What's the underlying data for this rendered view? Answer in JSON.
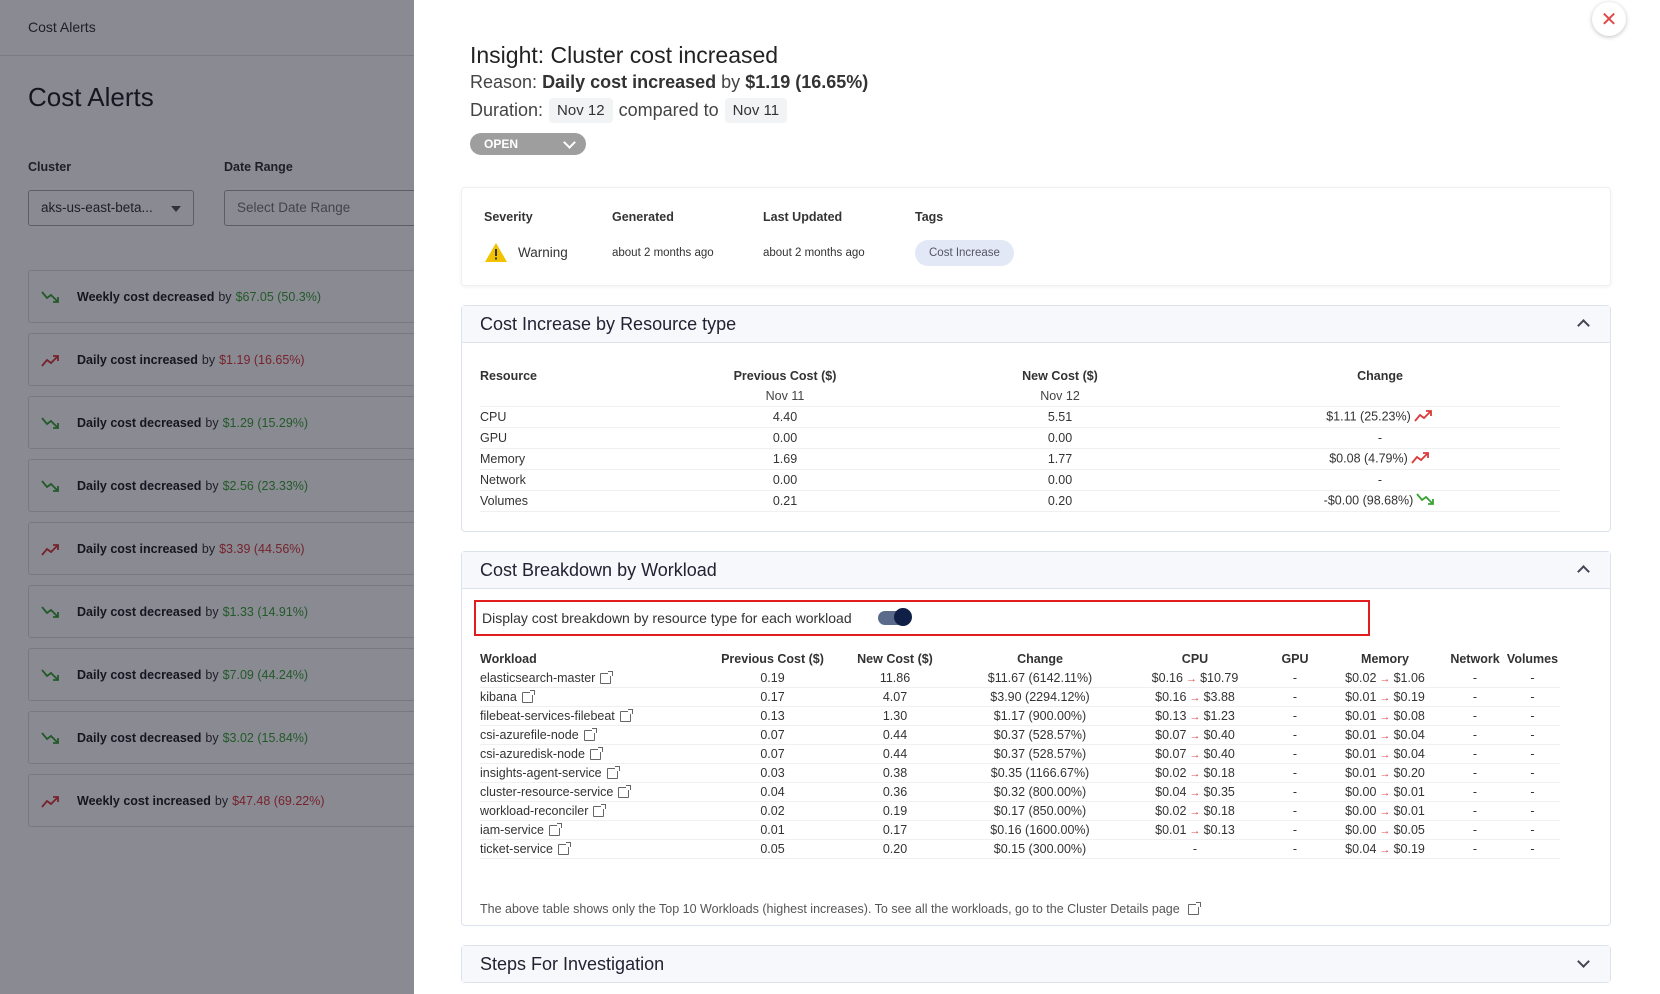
{
  "background": {
    "topbar_title": "Cost Alerts",
    "page_title": "Cost Alerts",
    "cluster_label": "Cluster",
    "cluster_value": "aks-us-east-beta...",
    "date_label": "Date Range",
    "date_placeholder": "Select Date Range",
    "alerts": [
      {
        "text": "Weekly cost decreased",
        "by": "by",
        "value": "$67.05 (50.3%)",
        "trend": "down"
      },
      {
        "text": "Daily cost increased",
        "by": "by",
        "value": "$1.19 (16.65%)",
        "trend": "up"
      },
      {
        "text": "Daily cost decreased",
        "by": "by",
        "value": "$1.29 (15.29%)",
        "trend": "down"
      },
      {
        "text": "Daily cost decreased",
        "by": "by",
        "value": "$2.56 (23.33%)",
        "trend": "down"
      },
      {
        "text": "Daily cost increased",
        "by": "by",
        "value": "$3.39 (44.56%)",
        "trend": "up"
      },
      {
        "text": "Daily cost decreased",
        "by": "by",
        "value": "$1.33 (14.91%)",
        "trend": "down"
      },
      {
        "text": "Daily cost decreased",
        "by": "by",
        "value": "$7.09 (44.24%)",
        "trend": "down"
      },
      {
        "text": "Daily cost decreased",
        "by": "by",
        "value": "$3.02 (15.84%)",
        "trend": "down"
      },
      {
        "text": "Weekly cost increased",
        "by": "by",
        "value": "$47.48 (69.22%)",
        "trend": "up"
      }
    ]
  },
  "insight": {
    "title": "Insight: Cluster cost increased",
    "reason_label": "Reason:",
    "reason_text": "Daily cost increased",
    "reason_by": "by",
    "reason_value": "$1.19 (16.65%)",
    "duration_label": "Duration:",
    "date_new": "Nov 12",
    "compared_to": "compared to",
    "date_old": "Nov 11",
    "status": "OPEN",
    "close_glyph": "✕"
  },
  "meta": {
    "severity_label": "Severity",
    "severity_value": "Warning",
    "generated_label": "Generated",
    "generated_value": "about 2 months ago",
    "updated_label": "Last Updated",
    "updated_value": "about 2 months ago",
    "tags_label": "Tags",
    "tag": "Cost Increase"
  },
  "resource_section": {
    "title": "Cost Increase by Resource type",
    "headers": [
      "Resource",
      "Previous Cost ($)",
      "New Cost ($)",
      "Change"
    ],
    "subheaders": [
      "",
      "Nov 11",
      "Nov 12",
      ""
    ],
    "rows": [
      {
        "resource": "CPU",
        "prev": "4.40",
        "new": "5.51",
        "change": "$1.11 (25.23%)",
        "trend": "up"
      },
      {
        "resource": "GPU",
        "prev": "0.00",
        "new": "0.00",
        "change": "-",
        "trend": ""
      },
      {
        "resource": "Memory",
        "prev": "1.69",
        "new": "1.77",
        "change": "$0.08 (4.79%)",
        "trend": "up"
      },
      {
        "resource": "Network",
        "prev": "0.00",
        "new": "0.00",
        "change": "-",
        "trend": ""
      },
      {
        "resource": "Volumes",
        "prev": "0.21",
        "new": "0.20",
        "change": "-$0.00 (98.68%)",
        "trend": "down"
      }
    ]
  },
  "workload_section": {
    "title": "Cost Breakdown by Workload",
    "toggle_label": "Display cost breakdown by resource type for each workload",
    "toggle_on": true,
    "headers": [
      "Workload",
      "Previous Cost ($)",
      "New Cost ($)",
      "Change",
      "CPU",
      "GPU",
      "Memory",
      "Network",
      "Volumes"
    ],
    "rows": [
      {
        "name": "elasticsearch-master",
        "prev": "0.19",
        "new": "11.86",
        "change": "$11.67 (6142.11%)",
        "cpu_from": "$0.16",
        "cpu_to": "$10.79",
        "gpu": "-",
        "mem_from": "$0.02",
        "mem_to": "$1.06",
        "net": "-",
        "vol": "-"
      },
      {
        "name": "kibana",
        "prev": "0.17",
        "new": "4.07",
        "change": "$3.90 (2294.12%)",
        "cpu_from": "$0.16",
        "cpu_to": "$3.88",
        "gpu": "-",
        "mem_from": "$0.01",
        "mem_to": "$0.19",
        "net": "-",
        "vol": "-"
      },
      {
        "name": "filebeat-services-filebeat",
        "prev": "0.13",
        "new": "1.30",
        "change": "$1.17 (900.00%)",
        "cpu_from": "$0.13",
        "cpu_to": "$1.23",
        "gpu": "-",
        "mem_from": "$0.01",
        "mem_to": "$0.08",
        "net": "-",
        "vol": "-"
      },
      {
        "name": "csi-azurefile-node",
        "prev": "0.07",
        "new": "0.44",
        "change": "$0.37 (528.57%)",
        "cpu_from": "$0.07",
        "cpu_to": "$0.40",
        "gpu": "-",
        "mem_from": "$0.01",
        "mem_to": "$0.04",
        "net": "-",
        "vol": "-"
      },
      {
        "name": "csi-azuredisk-node",
        "prev": "0.07",
        "new": "0.44",
        "change": "$0.37 (528.57%)",
        "cpu_from": "$0.07",
        "cpu_to": "$0.40",
        "gpu": "-",
        "mem_from": "$0.01",
        "mem_to": "$0.04",
        "net": "-",
        "vol": "-"
      },
      {
        "name": "insights-agent-service",
        "prev": "0.03",
        "new": "0.38",
        "change": "$0.35 (1166.67%)",
        "cpu_from": "$0.02",
        "cpu_to": "$0.18",
        "gpu": "-",
        "mem_from": "$0.01",
        "mem_to": "$0.20",
        "net": "-",
        "vol": "-"
      },
      {
        "name": "cluster-resource-service",
        "prev": "0.04",
        "new": "0.36",
        "change": "$0.32 (800.00%)",
        "cpu_from": "$0.04",
        "cpu_to": "$0.35",
        "gpu": "-",
        "mem_from": "$0.00",
        "mem_to": "$0.01",
        "net": "-",
        "vol": "-"
      },
      {
        "name": "workload-reconciler",
        "prev": "0.02",
        "new": "0.19",
        "change": "$0.17 (850.00%)",
        "cpu_from": "$0.02",
        "cpu_to": "$0.18",
        "gpu": "-",
        "mem_from": "$0.00",
        "mem_to": "$0.01",
        "net": "-",
        "vol": "-"
      },
      {
        "name": "iam-service",
        "prev": "0.01",
        "new": "0.17",
        "change": "$0.16 (1600.00%)",
        "cpu_from": "$0.01",
        "cpu_to": "$0.13",
        "gpu": "-",
        "mem_from": "$0.00",
        "mem_to": "$0.05",
        "net": "-",
        "vol": "-"
      },
      {
        "name": "ticket-service",
        "prev": "0.05",
        "new": "0.20",
        "change": "$0.15 (300.00%)",
        "cpu_from": "",
        "cpu_to": "",
        "cpu_text": "-",
        "gpu": "-",
        "mem_from": "$0.04",
        "mem_to": "$0.19",
        "net": "-",
        "vol": "-"
      }
    ],
    "footnote": "The above table shows only the Top 10 Workloads (highest increases). To see all the workloads, go to the Cluster Details page"
  },
  "steps_section": {
    "title": "Steps For Investigation"
  },
  "colors": {
    "increase": "#d93b3b",
    "decrease": "#3aa335",
    "highlight_border": "#e11d1d",
    "toggle_knob": "#0f1f45"
  }
}
